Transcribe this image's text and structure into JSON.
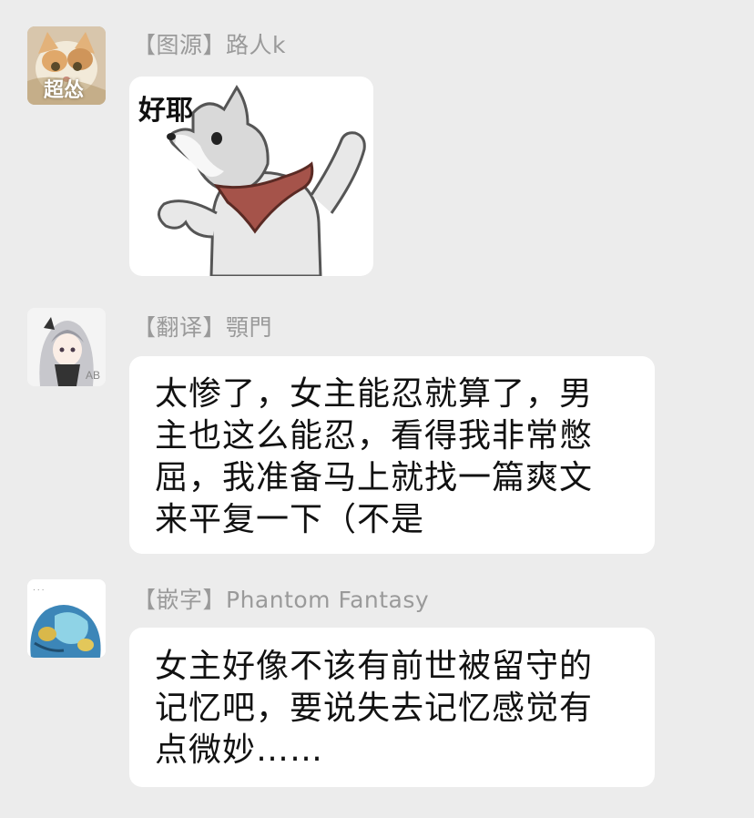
{
  "messages": [
    {
      "sender": "【图源】路人k",
      "avatar_text": "超怂",
      "type": "sticker",
      "sticker_caption": "好耶"
    },
    {
      "sender": "【翻译】顎門",
      "type": "text",
      "text": "太惨了，女主能忍就算了，男\n主也这么能忍，看得我非常憋\n屈，我准备马上就找一篇爽文\n来平复一下（不是"
    },
    {
      "sender": "【嵌字】Phantom Fantasy",
      "type": "text",
      "text": "女主好像不该有前世被留守的\n记忆吧，要说失去记忆感觉有\n点微妙……"
    }
  ],
  "colors": {
    "background": "#ececec",
    "bubble": "#ffffff",
    "sender_name": "#9a9a9a",
    "message_text": "#111111"
  }
}
